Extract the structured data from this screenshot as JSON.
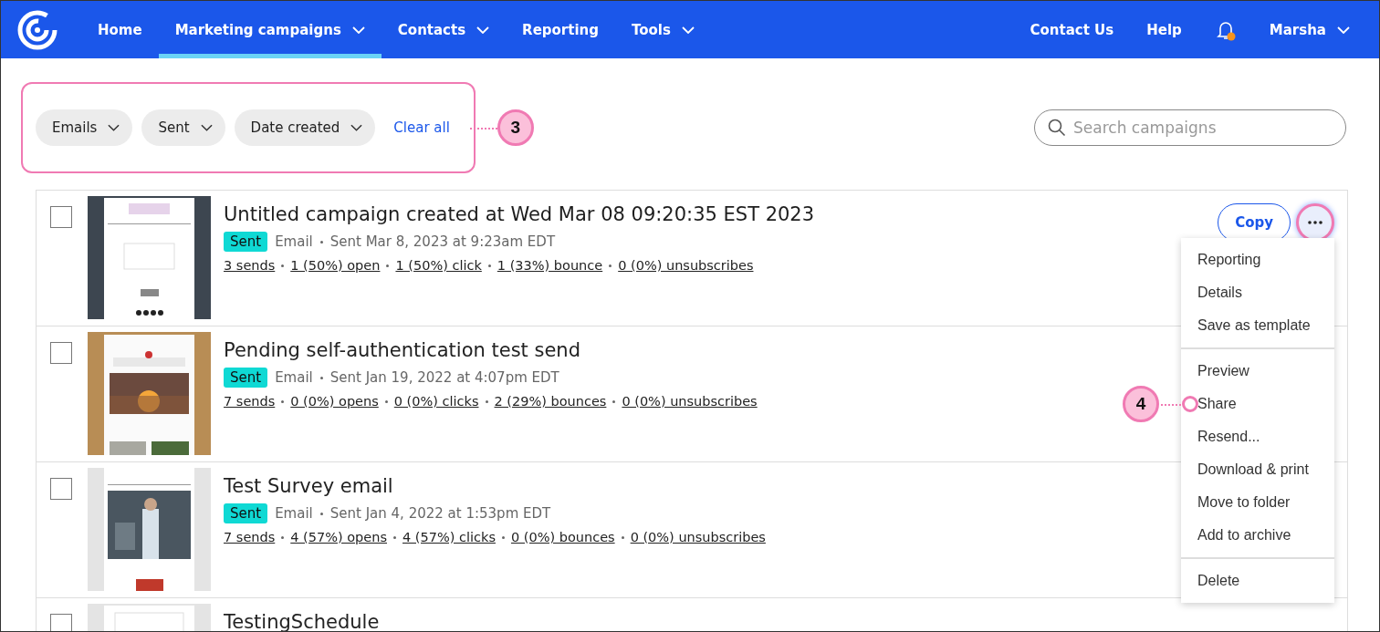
{
  "nav": {
    "items": [
      {
        "label": "Home",
        "dropdown": false,
        "selected": false
      },
      {
        "label": "Marketing campaigns",
        "dropdown": true,
        "selected": true
      },
      {
        "label": "Contacts",
        "dropdown": true,
        "selected": false
      },
      {
        "label": "Reporting",
        "dropdown": false,
        "selected": false
      },
      {
        "label": "Tools",
        "dropdown": true,
        "selected": false
      }
    ],
    "right": [
      {
        "kind": "link",
        "label": "Contact Us"
      },
      {
        "kind": "link",
        "label": "Help"
      },
      {
        "kind": "bell",
        "unread": true
      },
      {
        "kind": "user",
        "label": "Marsha"
      }
    ]
  },
  "filters": {
    "chips": [
      "Emails",
      "Sent",
      "Date created"
    ],
    "clear": "Clear all",
    "callout": "3"
  },
  "search": {
    "placeholder": "Search campaigns"
  },
  "campaigns": [
    {
      "title": "Untitled campaign created at Wed Mar 08 09:20:35 EST 2023",
      "status": "Sent",
      "type": "Email",
      "sent": "Sent Mar 8, 2023 at 9:23am EDT",
      "checked": false,
      "stats": [
        "3 sends",
        "1 (50%) open",
        "1 (50%) click",
        "1 (33%) bounce",
        "0 (0%) unsubscribes"
      ],
      "copy": "Copy",
      "menu_open": true
    },
    {
      "title": "Pending self-authentication test send",
      "status": "Sent",
      "type": "Email",
      "sent": "Sent Jan 19, 2022 at 4:07pm EDT",
      "checked": false,
      "stats": [
        "7 sends",
        "0 (0%) opens",
        "0 (0%) clicks",
        "2 (29%) bounces",
        "0 (0%) unsubscribes"
      ],
      "menu_open": false
    },
    {
      "title": "Test Survey email",
      "status": "Sent",
      "type": "Email",
      "sent": "Sent Jan 4, 2022 at 1:53pm EDT",
      "checked": false,
      "stats": [
        "7 sends",
        "4 (57%) opens",
        "4 (57%) clicks",
        "0 (0%) bounces",
        "0 (0%) unsubscribes"
      ],
      "menu_open": false
    },
    {
      "title": "TestingSchedule",
      "checked": false,
      "menu_open": false
    }
  ],
  "menu": {
    "callout": "4",
    "groups": [
      [
        {
          "label": "Reporting",
          "callout": false
        },
        {
          "label": "Details",
          "callout": false
        },
        {
          "label": "Save as template",
          "callout": false
        }
      ],
      [
        {
          "label": "Preview",
          "callout": false
        },
        {
          "label": "Share",
          "callout": true
        },
        {
          "label": "Resend...",
          "callout": false
        },
        {
          "label": "Download & print",
          "callout": false
        },
        {
          "label": "Move to folder",
          "callout": false
        },
        {
          "label": "Add to archive",
          "callout": false
        }
      ],
      [
        {
          "label": "Delete",
          "callout": false
        }
      ]
    ]
  }
}
